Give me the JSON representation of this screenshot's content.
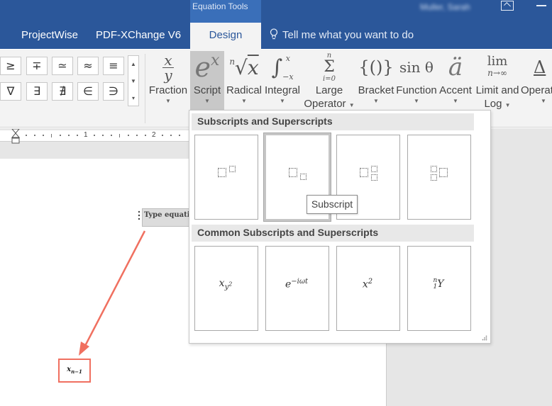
{
  "titlebar": {
    "contextual_tab_group": "Equation Tools",
    "user_name": "Muller, Sarah"
  },
  "tabs": [
    {
      "label": "ProjectWise"
    },
    {
      "label": "PDF-XChange V6"
    },
    {
      "label": "Design"
    }
  ],
  "tell_me": {
    "text": "Tell me what you want to do"
  },
  "symbols": {
    "row1": [
      "≥",
      "∓",
      "≃",
      "≈",
      "≡"
    ],
    "row2": [
      "∇",
      "∃",
      "∄",
      "∈",
      "∋"
    ]
  },
  "ribbon_buttons": [
    {
      "label": "Fraction",
      "label2": ""
    },
    {
      "label": "Script",
      "label2": ""
    },
    {
      "label": "Radical",
      "label2": ""
    },
    {
      "label": "Integral",
      "label2": ""
    },
    {
      "label": "Large",
      "label2": "Operator"
    },
    {
      "label": "Bracket",
      "label2": ""
    },
    {
      "label": "Function",
      "label2": ""
    },
    {
      "label": "Accent",
      "label2": ""
    },
    {
      "label": "Limit and",
      "label2": "Log"
    },
    {
      "label": "Operat",
      "label2": ""
    }
  ],
  "ruler": {
    "numbers": [
      "1",
      "2"
    ]
  },
  "document": {
    "equation_placeholder": "Type equation here.",
    "result_text": "xn−1"
  },
  "script_gallery": {
    "section1_title": "Subscripts and Superscripts",
    "section2_title": "Common Subscripts and Superscripts",
    "tooltip": "Subscript",
    "selected_item": "Subscript",
    "common_items": [
      "xy²",
      "e−iωt",
      "x²",
      "ⁿ₁Y"
    ]
  },
  "colors": {
    "title_bar": "#2b579a",
    "ribbon_bg": "#f3f3f3",
    "annotation_arrow": "#f07060"
  }
}
